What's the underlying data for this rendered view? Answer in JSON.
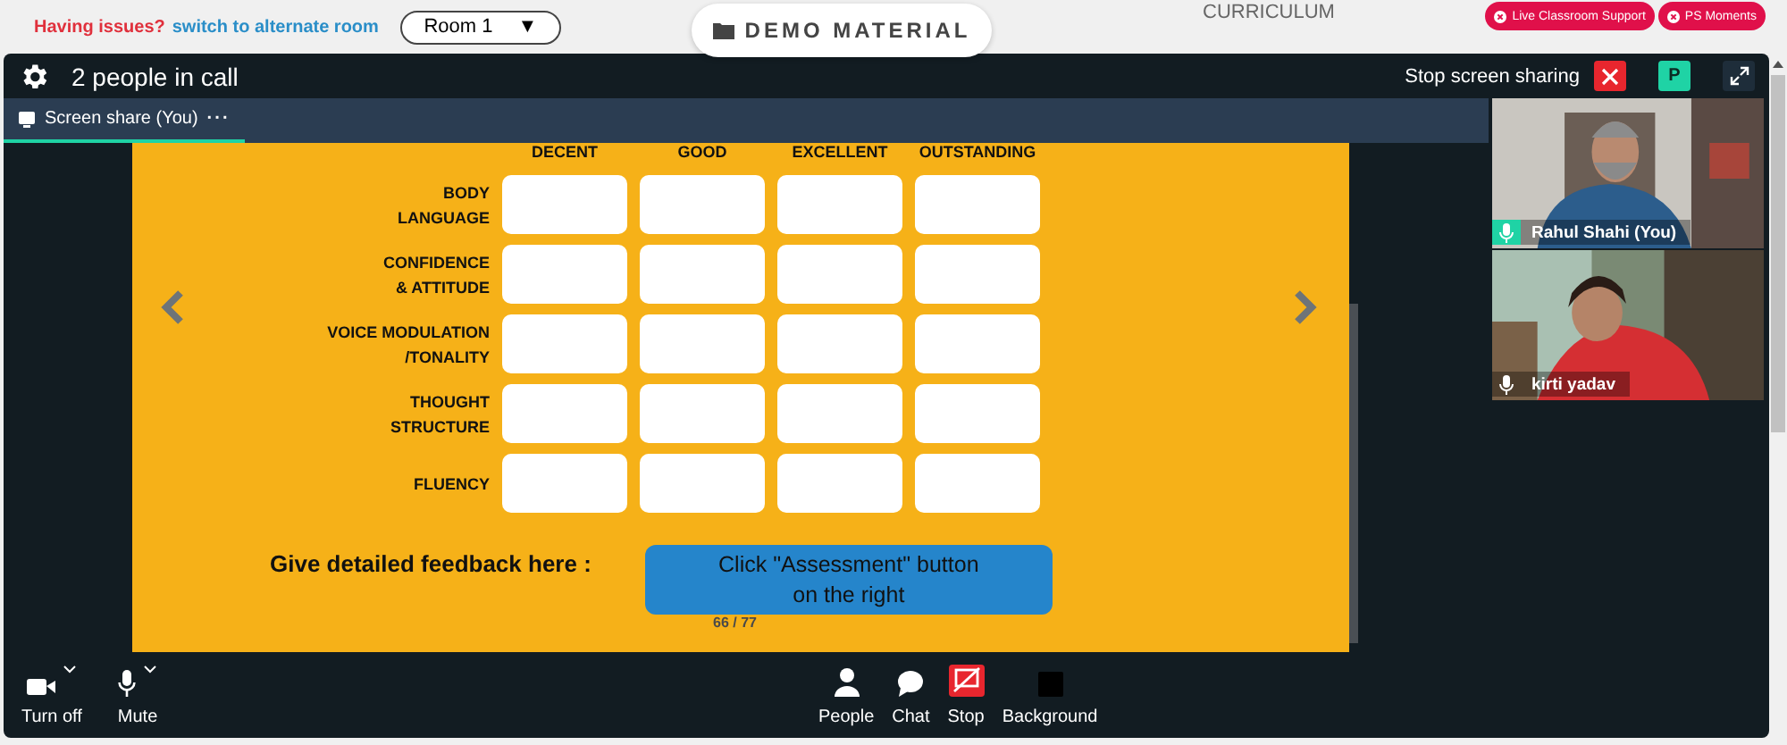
{
  "top_bar": {
    "issue_text": "Having issues?",
    "switch_link": "switch to alternate room",
    "room_select": "Room 1",
    "room_caret": "▼",
    "demo_button": "DEMO MATERIAL",
    "curriculum": "CURRICULUM",
    "badges": [
      "Live Classroom Support",
      "PS Moments"
    ]
  },
  "call": {
    "title": "2 people in call",
    "stop_sharing": "Stop screen sharing",
    "avatar": "P"
  },
  "tab": {
    "label": "Screen share (You)",
    "more": "···",
    "selected": true
  },
  "slide": {
    "columns": [
      "DECENT",
      "GOOD",
      "EXCELLENT",
      "OUTSTANDING"
    ],
    "rows": [
      "BODY\nLANGUAGE",
      "CONFIDENCE\n& ATTITUDE",
      "VOICE MODULATION\n/TONALITY",
      "THOUGHT\nSTRUCTURE",
      "FLUENCY"
    ],
    "feedback_label": "Give detailed feedback here :",
    "assessment_note": "Click \"Assessment\" button\non the right",
    "page": "66 / 77"
  },
  "participants": [
    {
      "name": "Rahul Shahi (You)",
      "speaking": true,
      "kind": "man"
    },
    {
      "name": "kirti yadav",
      "speaking": false,
      "kind": "woman"
    }
  ],
  "toolbar_left": [
    {
      "kind": "camera",
      "label": "Turn off"
    },
    {
      "kind": "mic",
      "label": "Mute"
    }
  ],
  "toolbar_center": [
    {
      "kind": "people",
      "label": "People"
    },
    {
      "kind": "chat",
      "label": "Chat"
    },
    {
      "kind": "stop",
      "label": "Stop"
    },
    {
      "kind": "background",
      "label": "Background"
    }
  ]
}
